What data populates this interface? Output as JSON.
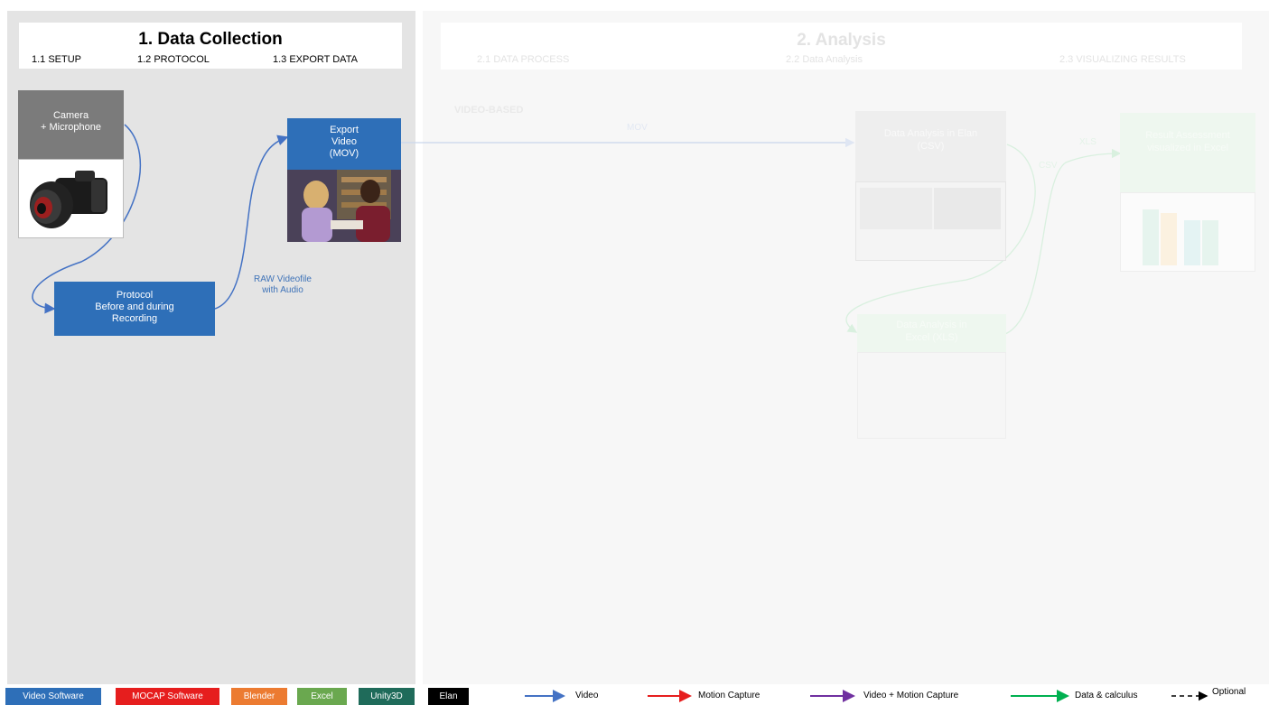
{
  "section1": {
    "title": "1. Data Collection",
    "sub1": "1.1 SETUP",
    "sub2": "1.2 PROTOCOL",
    "sub3": "1.3 EXPORT DATA"
  },
  "section2": {
    "title": "2. Analysis",
    "sub1": "2.1 DATA PROCESS",
    "sub2": "2.2 Data Analysis",
    "sub3": "2.3 VISUALIZING RESULTS",
    "track": "VIDEO-BASED",
    "edge_mov": "MOV",
    "edge_csv": "CSV",
    "edge_xls": "XLS",
    "node_elan": "Data Analysis in Elan (CSV)",
    "node_excel": "Data Analysis in Excel (XLS)",
    "node_result": "Result Assessment visualized in Excel"
  },
  "nodes": {
    "camera_line1": "Camera",
    "camera_line2": "+ Microphone",
    "protocol_line1": "Protocol",
    "protocol_line2": "Before and during",
    "protocol_line3": "Recording",
    "export_line1": "Export",
    "export_line2": "Video",
    "export_line3": "(MOV)"
  },
  "edges": {
    "raw_line1": "RAW Videofile",
    "raw_line2": "with Audio"
  },
  "legend": {
    "chips": [
      {
        "label": "Video Software",
        "color": "#2e6fb8"
      },
      {
        "label": "MOCAP Software",
        "color": "#e61e1e"
      },
      {
        "label": "Blender",
        "color": "#ec7b31"
      },
      {
        "label": "Excel",
        "color": "#6aa84f"
      },
      {
        "label": "Unity3D",
        "color": "#1f6b5a"
      },
      {
        "label": "Elan",
        "color": "#000000"
      }
    ],
    "arrows": [
      {
        "label": "Video",
        "color": "#4472c4"
      },
      {
        "label": "Motion Capture",
        "color": "#e61e1e"
      },
      {
        "label": "Video + Motion Capture",
        "color": "#7030a0"
      },
      {
        "label": "Data & calculus",
        "color": "#00b050"
      },
      {
        "label": "Optional",
        "color": "#000000"
      }
    ]
  }
}
